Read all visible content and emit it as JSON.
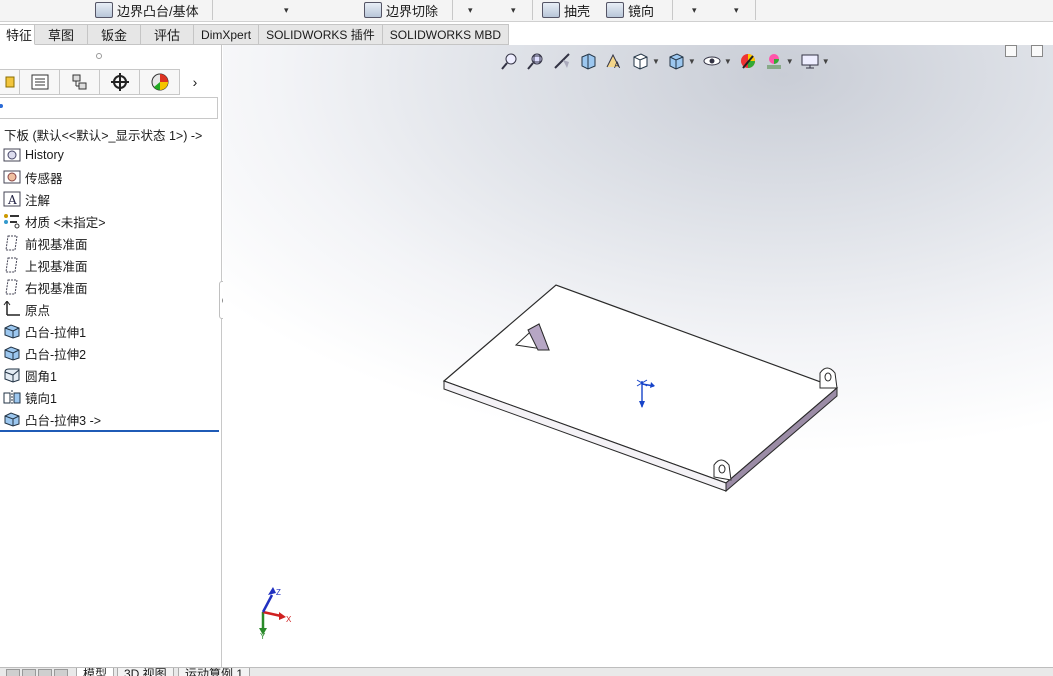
{
  "ribbon": {
    "items": [
      {
        "label": "边界凸台/基体",
        "icon": "boundary-boss-icon"
      },
      {
        "label": "边界切除",
        "icon": "boundary-cut-icon"
      },
      {
        "label": "抽壳",
        "icon": "shell-icon"
      },
      {
        "label": "镜向",
        "icon": "mirror-icon"
      }
    ]
  },
  "tabs": [
    "特征",
    "草图",
    "钣金",
    "评估",
    "DimXpert",
    "SOLIDWORKS 插件",
    "SOLIDWORKS MBD"
  ],
  "active_tab": "特征",
  "manager_icons": [
    "feature-manager-icon",
    "property-manager-icon",
    "configuration-manager-icon",
    "dimxpert-manager-icon",
    "display-manager-icon"
  ],
  "tree": {
    "root": "下板  (默认<<默认>_显示状态 1>) ->",
    "items": [
      {
        "label": "History",
        "icon": "history-folder-icon"
      },
      {
        "label": "传感器",
        "icon": "sensor-icon"
      },
      {
        "label": "注解",
        "icon": "annotation-icon"
      },
      {
        "label": "材质 <未指定>",
        "icon": "material-icon"
      },
      {
        "label": "前视基准面",
        "icon": "plane-icon"
      },
      {
        "label": "上视基准面",
        "icon": "plane-icon"
      },
      {
        "label": "右视基准面",
        "icon": "plane-icon"
      },
      {
        "label": "原点",
        "icon": "origin-icon"
      },
      {
        "label": "凸台-拉伸1",
        "icon": "extrude-icon"
      },
      {
        "label": "凸台-拉伸2",
        "icon": "extrude-icon"
      },
      {
        "label": "圆角1",
        "icon": "fillet-icon"
      },
      {
        "label": "镜向1",
        "icon": "mirror-feature-icon"
      },
      {
        "label": "凸台-拉伸3 ->",
        "icon": "extrude-icon"
      }
    ]
  },
  "triad": {
    "x": "X",
    "y": "Y",
    "z": "Z"
  },
  "bottom_tabs": [
    "模型",
    "3D 视图",
    "运动算例 1"
  ]
}
